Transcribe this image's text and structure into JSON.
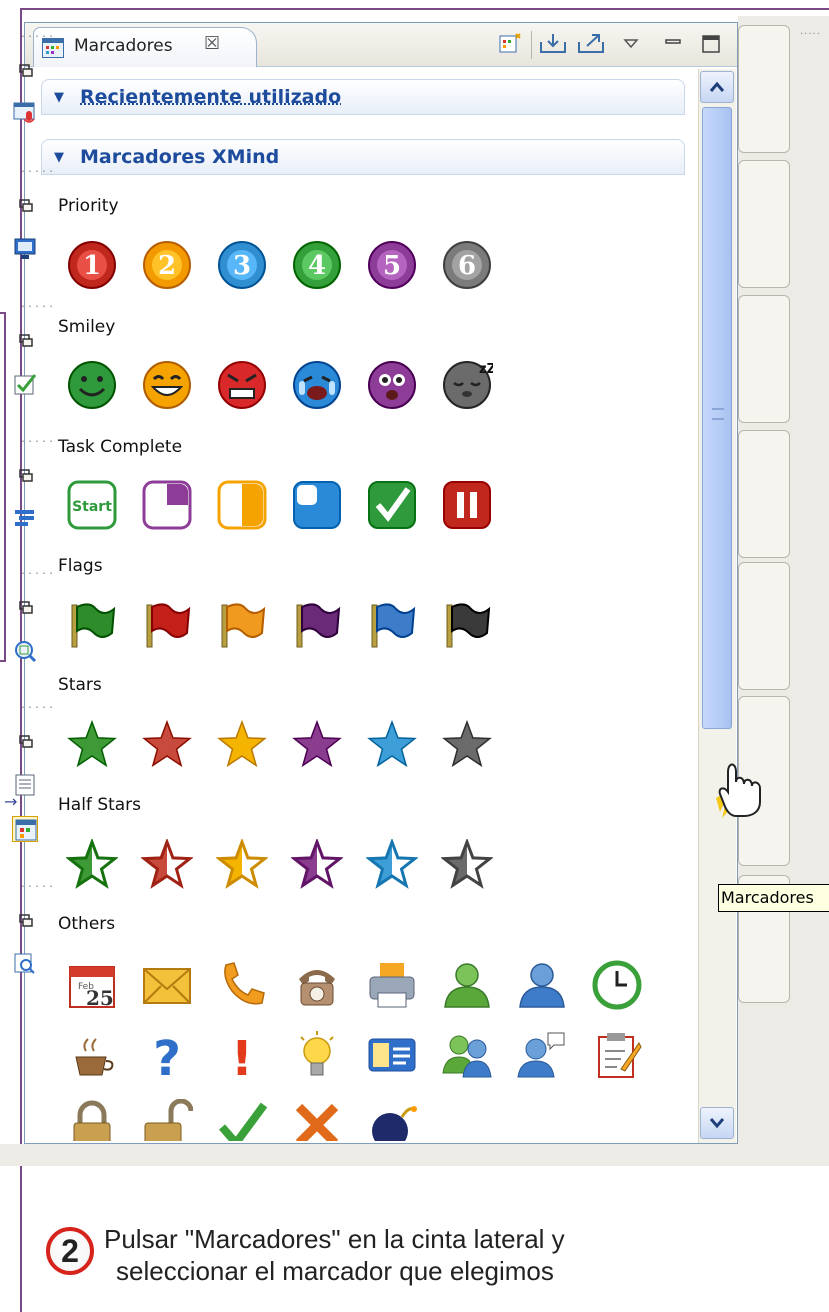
{
  "panel": {
    "tab_label": "Marcadores",
    "tab_close": "☒",
    "tab_icon": "markers-view-icon",
    "toolbar": [
      {
        "name": "marker-manage-icon"
      },
      {
        "name": "import-icon"
      },
      {
        "name": "export-icon"
      },
      {
        "name": "view-menu-icon"
      },
      {
        "name": "minimize-icon"
      },
      {
        "name": "maximize-icon"
      }
    ]
  },
  "sections": {
    "recent": "Recientemente utilizado",
    "xmind": "Marcadores XMind"
  },
  "categories": [
    {
      "label": "Priority",
      "icons": [
        "priority-1-icon",
        "priority-2-icon",
        "priority-3-icon",
        "priority-4-icon",
        "priority-5-icon",
        "priority-6-icon"
      ],
      "glyphs": [
        "1",
        "2",
        "3",
        "4",
        "5",
        "6"
      ],
      "colors": [
        "#c0281e",
        "#f39a00",
        "#2f8fd0",
        "#34a03a",
        "#8d3c97",
        "#7b7b7b"
      ]
    },
    {
      "label": "Smiley",
      "icons": [
        "smiley-smile-icon",
        "smiley-laugh-icon",
        "smiley-angry-icon",
        "smiley-cry-icon",
        "smiley-surprise-icon",
        "smiley-sleep-icon"
      ],
      "colors": [
        "#2f9a3b",
        "#f5a300",
        "#d8282a",
        "#2b8ad8",
        "#8d3c97",
        "#6b6b6b"
      ]
    },
    {
      "label": "Task Complete",
      "icons": [
        "task-start-icon",
        "task-quarter-icon",
        "task-half-icon",
        "task-3quarter-icon",
        "task-done-icon",
        "task-pause-icon"
      ],
      "start_text": "Start",
      "colors": [
        "#2f9a3b",
        "#8d3c97",
        "#f5a300",
        "#2b8ad8",
        "#2f9a3b",
        "#c0281e"
      ]
    },
    {
      "label": "Flags",
      "icons": [
        "flag-green-icon",
        "flag-red-icon",
        "flag-orange-icon",
        "flag-purple-icon",
        "flag-blue-icon",
        "flag-black-icon"
      ],
      "colors": [
        "#2e8c2a",
        "#c3201a",
        "#f09a20",
        "#6a2a78",
        "#3d7cc9",
        "#3a3a3a"
      ]
    },
    {
      "label": "Stars",
      "icons": [
        "star-green-icon",
        "star-red-icon",
        "star-yellow-icon",
        "star-purple-icon",
        "star-blue-icon",
        "star-grey-icon"
      ],
      "colors": [
        "#3e9a36",
        "#c84a3c",
        "#f5b400",
        "#8a3c8f",
        "#3e9ed8",
        "#6b6b6b"
      ]
    },
    {
      "label": "Half Stars",
      "icons": [
        "half-star-green-icon",
        "half-star-red-icon",
        "half-star-yellow-icon",
        "half-star-purple-icon",
        "half-star-blue-icon",
        "half-star-grey-icon"
      ],
      "colors": [
        "#3e9a36",
        "#c84a3c",
        "#f5b400",
        "#8a3c8f",
        "#3e9ed8",
        "#6b6b6b"
      ]
    },
    {
      "label": "Others",
      "icons": [
        "calendar-icon",
        "envelope-icon",
        "phone-icon",
        "telephone-icon",
        "printer-icon",
        "user-green-icon",
        "user-blue-icon",
        "clock-icon",
        "coffee-icon",
        "question-icon",
        "exclamation-icon",
        "lightbulb-icon",
        "id-card-icon",
        "people-icon",
        "user-speech-icon",
        "clipboard-icon",
        "lock-closed-icon",
        "lock-open-icon",
        "checkmark-icon",
        "cross-icon",
        "bomb-icon"
      ],
      "calendar_month": "Feb",
      "calendar_day": "25"
    }
  ],
  "trim_bar": {
    "groups": [
      {
        "icon": "presentation-audio-icon"
      },
      {
        "icon": "monitor-icon"
      },
      {
        "icon": "task-check-icon"
      },
      {
        "icon": "outline-icon"
      },
      {
        "icon": "zoom-icon"
      },
      {
        "icon": "notes-icon",
        "icon2": "markers-trim-icon"
      },
      {
        "icon": "search-view-icon"
      }
    ],
    "tooltip": "Marcadores"
  },
  "instruction": {
    "step": "2",
    "line1": "Pulsar \"Marcadores\" en la cinta lateral y",
    "line2": "seleccionar el marcador que elegimos"
  }
}
